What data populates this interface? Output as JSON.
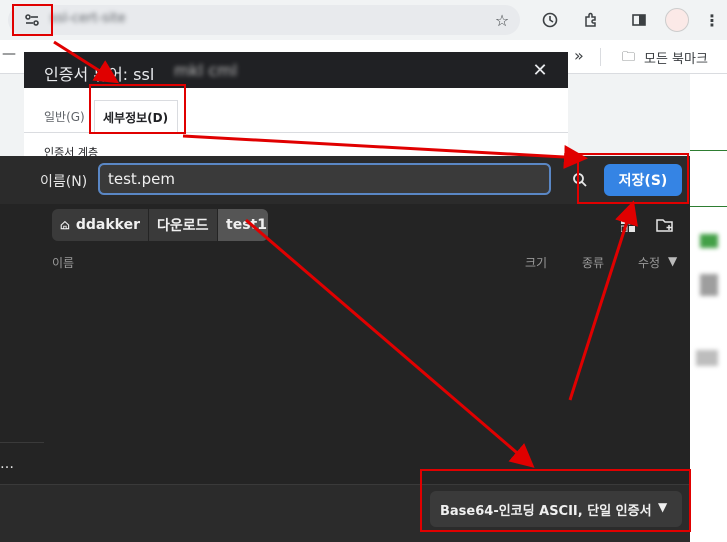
{
  "browser": {
    "url": "ssl-cert-site",
    "bookmarks_partial": "모든 북마크",
    "bookmarks_chevron": "»",
    "bookmark_first": "—"
  },
  "cert_viewer": {
    "title": "인증서 뷰어: ssl",
    "title_redacted": "mkl cml",
    "tab_general": "일반(G)",
    "tab_details": "세부정보(D)",
    "hierarchy_label": "인증서 계층"
  },
  "save_dialog": {
    "name_label": "이름(N)",
    "filename": "test.pem",
    "save_button": "저장(S)",
    "breadcrumb": [
      "ddakker",
      "다운로드",
      "test1"
    ],
    "columns": {
      "name": "이름",
      "size": "크기",
      "type": "종류",
      "modified": "수정"
    },
    "sidebar_more": "…",
    "format": "Base64-인코딩 ASCII, 단일 인증서"
  },
  "colors": {
    "annotation": "#e00000",
    "save_accent": "#3584e4"
  }
}
